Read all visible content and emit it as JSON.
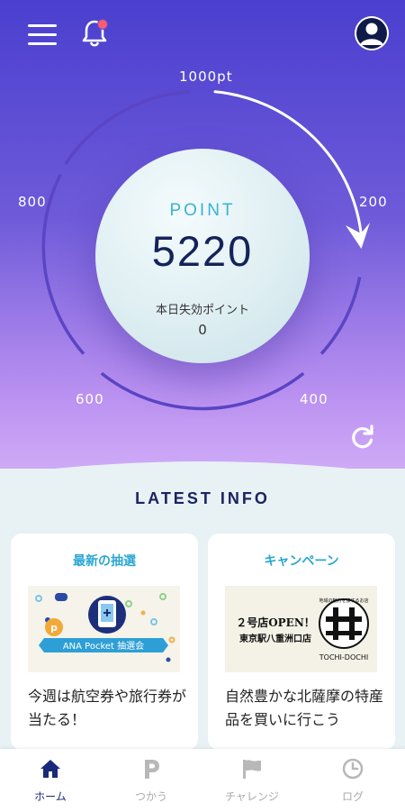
{
  "header": {
    "menu_icon": "hamburger-menu-icon",
    "notification_icon": "bell-icon",
    "notification_badge_color": "#ff5a6e",
    "profile_icon": "user-avatar-icon"
  },
  "gauge": {
    "ticks": [
      "1000pt",
      "200",
      "400",
      "600",
      "800"
    ],
    "point_label": "POINT",
    "point_value": "5220",
    "expire_label": "本日失効ポイント",
    "expire_value": "0",
    "refresh_icon": "refresh-icon"
  },
  "latest": {
    "title": "LATEST INFO",
    "cards": [
      {
        "title": "最新の抽選",
        "banner_text": "ANA Pocket 抽選会",
        "text": "今週は航空券や旅行券が当たる！"
      },
      {
        "title": "キャンペーン",
        "banner_line1": "２号店OPEN！",
        "banner_line2": "東京駅八重洲口店",
        "banner_logo_caption": "TOCHI-DOCHI",
        "banner_logo_arc": "地域の魅力を旅するお店",
        "text": "自然豊かな北薩摩の特産品を買いに行こう"
      }
    ]
  },
  "tabs": [
    {
      "label": "ホーム",
      "icon": "home-icon",
      "active": true
    },
    {
      "label": "つかう",
      "icon": "p-icon",
      "active": false
    },
    {
      "label": "チャレンジ",
      "icon": "flag-icon",
      "active": false
    },
    {
      "label": "ログ",
      "icon": "clock-icon",
      "active": false
    }
  ],
  "colors": {
    "accent": "#36b4d5",
    "navy": "#15235a",
    "active_tab": "#1a2a7a"
  }
}
